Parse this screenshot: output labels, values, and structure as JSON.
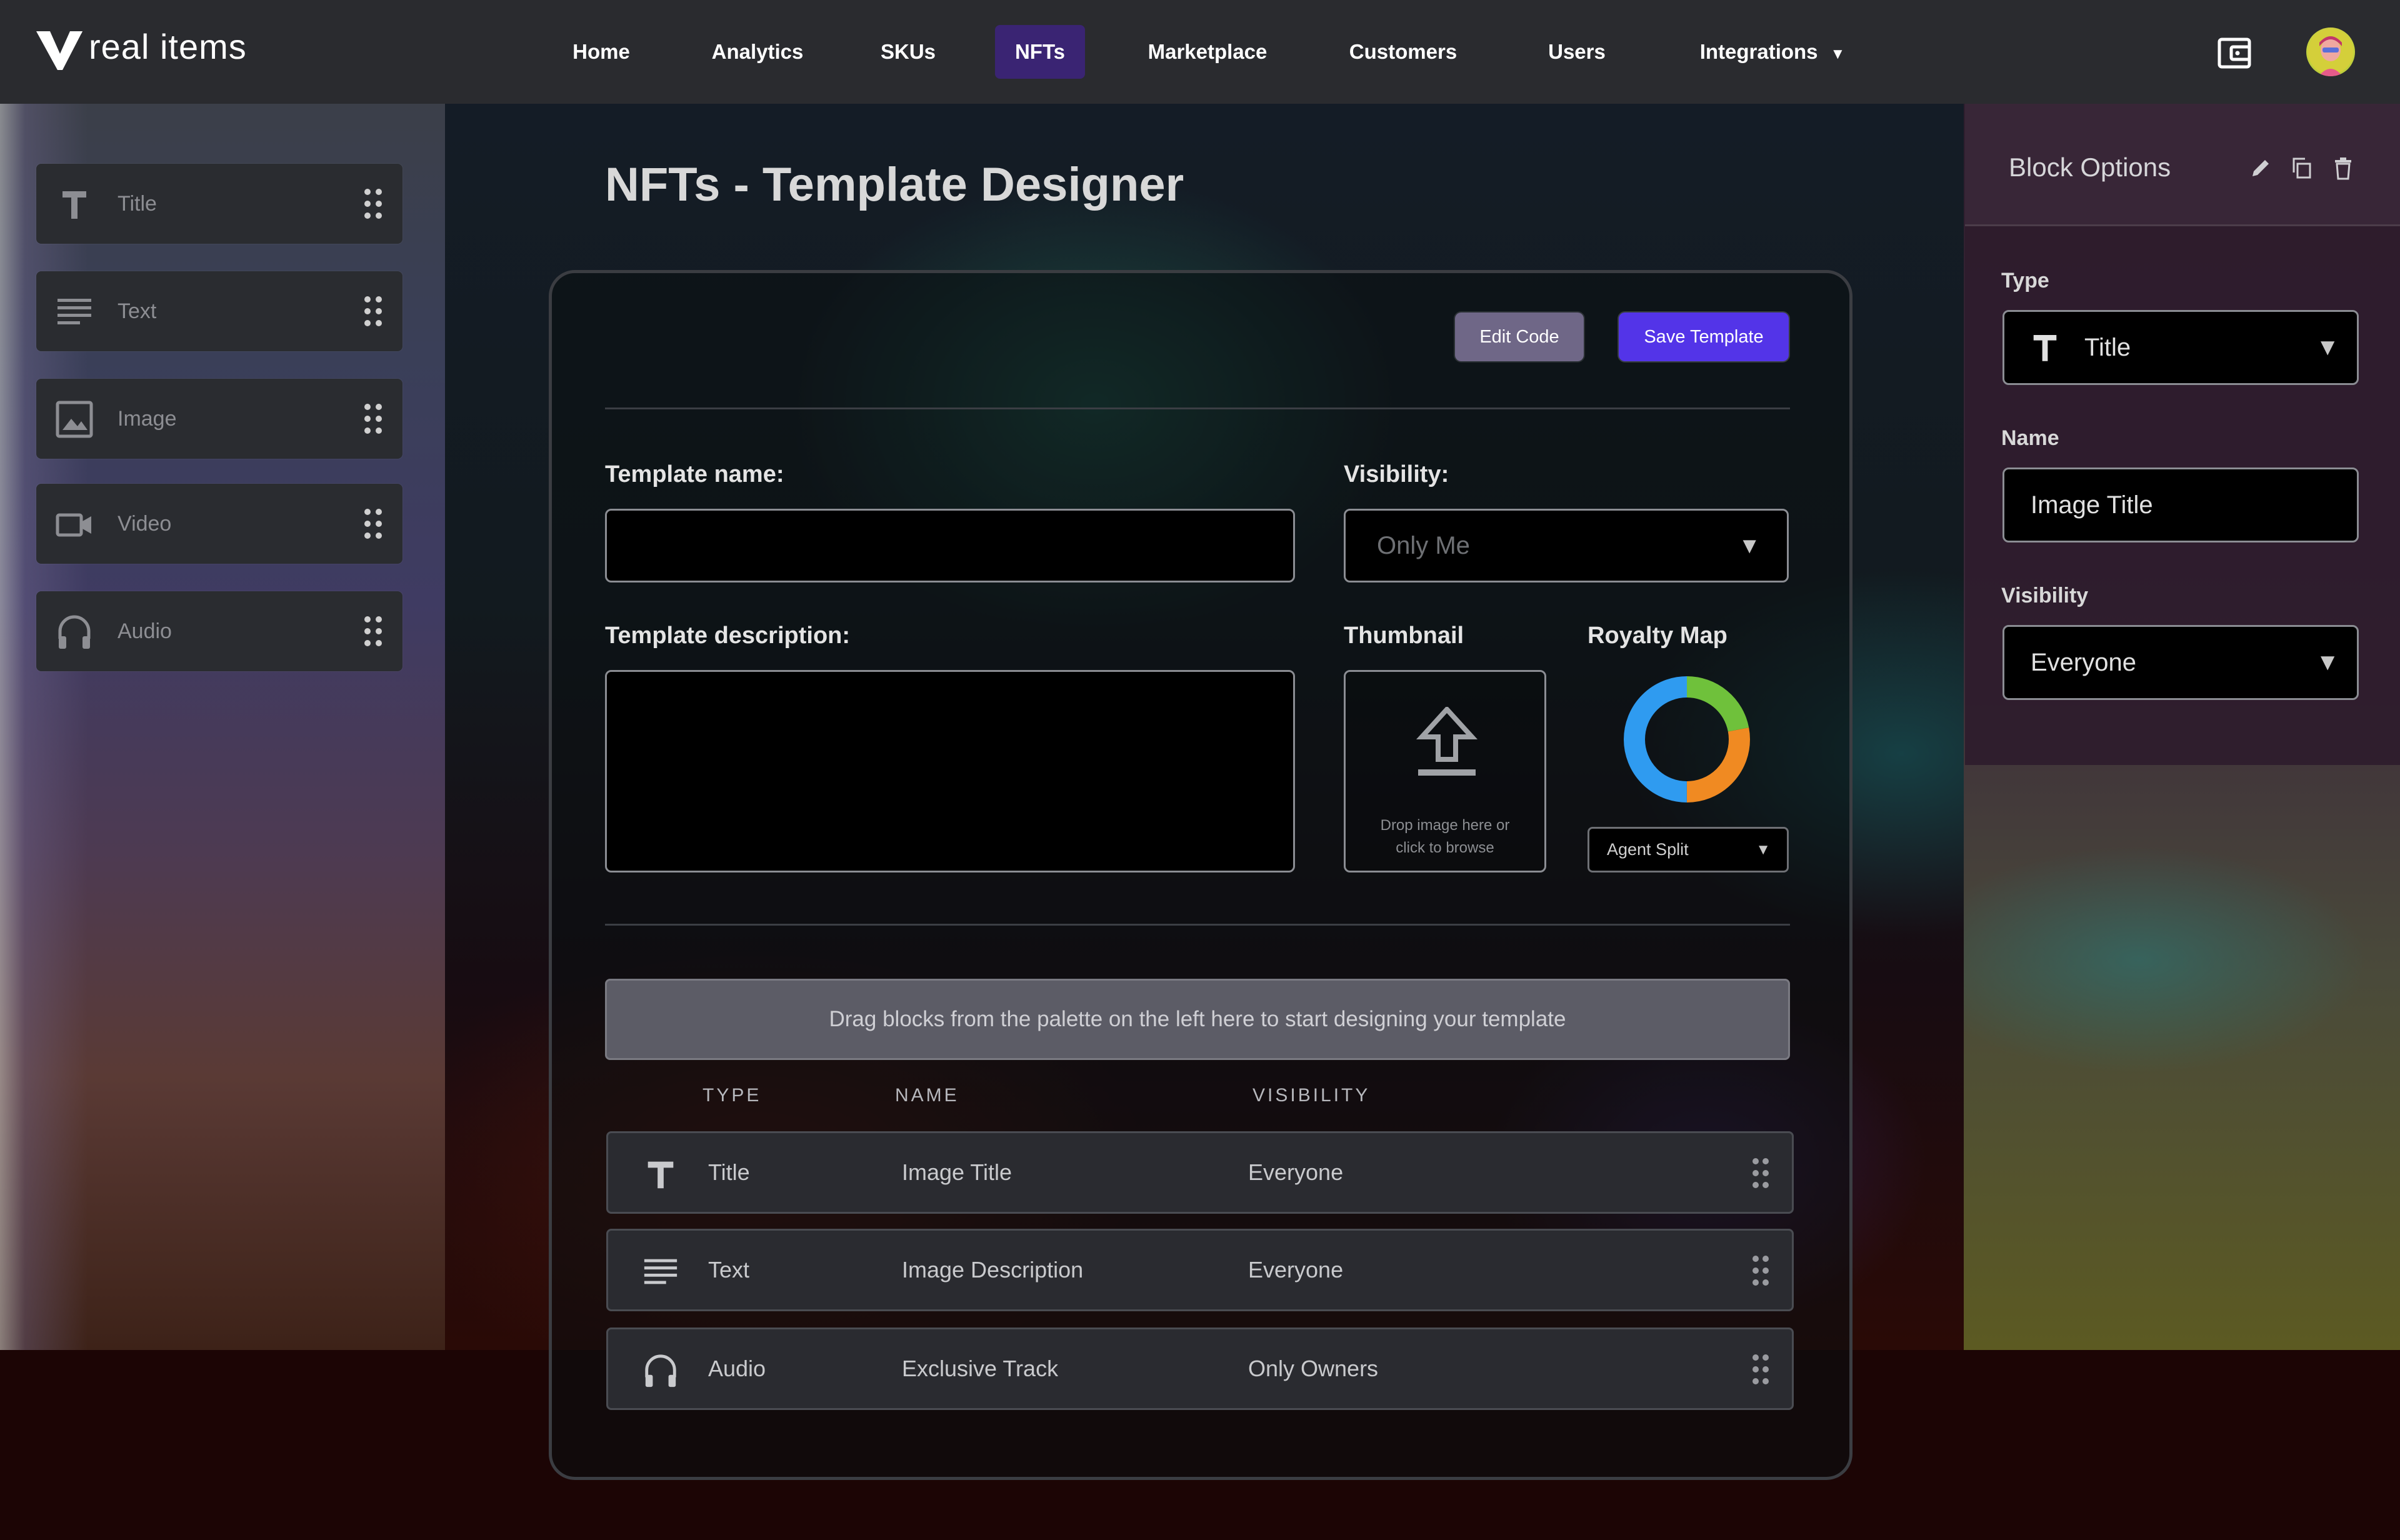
{
  "app": {
    "logo_text": "real items"
  },
  "nav": {
    "items": [
      {
        "label": "Home"
      },
      {
        "label": "Analytics"
      },
      {
        "label": "SKUs"
      },
      {
        "label": "NFTs",
        "active": true
      },
      {
        "label": "Marketplace"
      },
      {
        "label": "Customers"
      },
      {
        "label": "Users"
      },
      {
        "label": "Integrations"
      }
    ],
    "integrations_caret": "▼",
    "icons": {
      "wallet": "wallet-icon",
      "avatar": "avatar"
    }
  },
  "palette": {
    "items": [
      {
        "label": "Title",
        "icon": "title-type-icon"
      },
      {
        "label": "Text",
        "icon": "text-lines-icon"
      },
      {
        "label": "Image",
        "icon": "image-icon"
      },
      {
        "label": "Video",
        "icon": "video-camera-icon"
      },
      {
        "label": "Audio",
        "icon": "headphones-icon"
      }
    ]
  },
  "page": {
    "title": "NFTs - Template Designer"
  },
  "toolbar": {
    "edit_code_label": "Edit Code",
    "save_template_label": "Save Template"
  },
  "form": {
    "template_name_label": "Template name:",
    "template_name_value": "",
    "visibility_label": "Visibility:",
    "visibility_value": "Only Me",
    "template_description_label": "Template description:",
    "template_description_value": "",
    "thumbnail_label": "Thumbnail",
    "thumbnail_hint_line1": "Drop image here or",
    "thumbnail_hint_line2": "click to browse",
    "royalty_map_label": "Royalty Map",
    "royalty_select_value": "Agent Split",
    "caret": "▼"
  },
  "royalty_chart": {
    "segments": [
      {
        "fraction": 0.22,
        "color": "#6fc13b"
      },
      {
        "fraction": 0.28,
        "color": "#f08a22"
      },
      {
        "fraction": 0.5,
        "color": "#2f9bf0"
      }
    ]
  },
  "blocks": {
    "drop_hint": "Drag blocks from the palette on the left here to start designing your template",
    "headers": {
      "type": "TYPE",
      "name": "NAME",
      "visibility": "VISIBILITY"
    },
    "rows": [
      {
        "type": "Title",
        "name": "Image Title",
        "visibility": "Everyone",
        "icon": "title-type-icon"
      },
      {
        "type": "Text",
        "name": "Image Description",
        "visibility": "Everyone",
        "icon": "text-lines-icon"
      },
      {
        "type": "Audio",
        "name": "Exclusive Track",
        "visibility": "Only Owners",
        "icon": "headphones-icon"
      }
    ]
  },
  "block_options": {
    "title": "Block Options",
    "icons": [
      "edit-pencil-icon",
      "copy-icon",
      "trash-icon"
    ],
    "type_label": "Type",
    "type_value": "Title",
    "name_label": "Name",
    "name_value": "Image Title",
    "visibility_label": "Visibility",
    "visibility_value": "Everyone",
    "caret": "▼"
  },
  "colors": {
    "nav_bg": "#2a2b2f",
    "nav_active": "#3a2473",
    "save_button": "#5334e8",
    "edit_button": "#6f6787",
    "panel_bg": "#2a2c30"
  }
}
